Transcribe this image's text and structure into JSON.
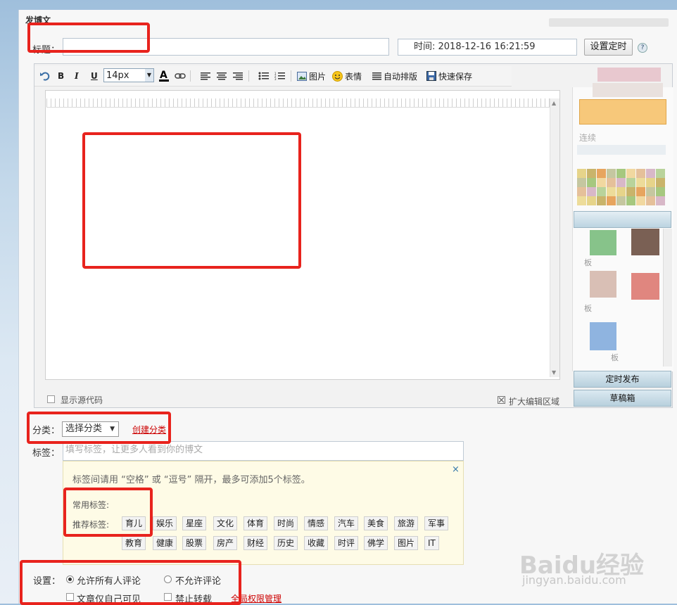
{
  "page": {
    "heading": "发博文"
  },
  "title_row": {
    "title_label": "标题：",
    "title_value": "",
    "time_text": "时间: 2018-12-16 16:21:59",
    "schedule_button": "设置定时",
    "help_icon": "?"
  },
  "toolbar": {
    "font_size": "14px",
    "image_label": "图片",
    "emoji_label": "表情",
    "autoformat_label": "自动排版",
    "quicksave_label": "快速保存"
  },
  "editor": {
    "show_source_label": "显示源代码",
    "expand_label": "扩大编辑区域"
  },
  "side_panel": {
    "partial_text_1": "连续",
    "partial_text_2": "板",
    "partial_text_3": "板",
    "partial_text_4": "板",
    "timed_publish_button": "定时发布",
    "drafts_button": "草稿箱"
  },
  "category": {
    "label": "分类：",
    "select_value": "选择分类",
    "create_link": "创建分类"
  },
  "tags": {
    "label": "标签：",
    "placeholder": "填写标签，让更多人看到你的博文",
    "hint": "标签间请用 “空格” 或 “逗号” 隔开，最多可添加5个标签。",
    "close_icon": "×",
    "common_label": "常用标签:",
    "recommended_label": "推荐标签:",
    "recommended_row1": [
      "育儿",
      "娱乐",
      "星座",
      "文化",
      "体育",
      "时尚",
      "情感",
      "汽车",
      "美食",
      "旅游",
      "军事"
    ],
    "recommended_row2": [
      "教育",
      "健康",
      "股票",
      "房产",
      "财经",
      "历史",
      "收藏",
      "时评",
      "佛学",
      "图片",
      "IT"
    ]
  },
  "settings": {
    "label": "设置：",
    "allow_all_comments": "允许所有人评论",
    "disallow_comments": "不允许评论",
    "private_only": "文章仅自己可见",
    "no_repost": "禁止转载",
    "permission_link": "全局权限管理"
  },
  "watermark": {
    "logo_text": "Baidu经验",
    "url_text": "jingyan.baidu.com"
  },
  "colors": {
    "annotation_red": "#e8231d",
    "link_red": "#cc0000",
    "hint_bg": "#fefbe6",
    "side_button_bg": "#c9dce7"
  }
}
